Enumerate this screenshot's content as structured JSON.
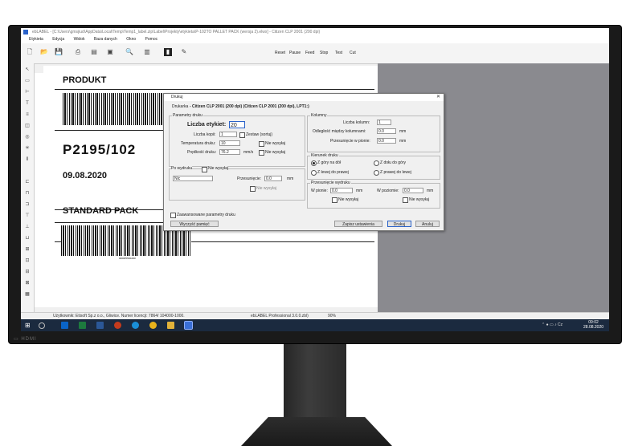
{
  "app": {
    "title": "ebLABEL - [C:\\Users\\gmsjiud\\AppData\\Local\\Temp\\Temp1_label.zip\\Label\\Projekty\\etykieta\\P-102TO PALLET PACK (wersja 2).elwx] - Citizen CLP 2001 (200 dpi)",
    "menu": [
      "Etykieta",
      "Edycja",
      "Widok",
      "Baza danych",
      "Okno",
      "Pomoc"
    ],
    "toolbar_text_buttons": [
      "Reset",
      "Pause",
      "Feed",
      "Stop",
      "Test",
      "Cut"
    ]
  },
  "label": {
    "produkt": "PRODUKT",
    "code": "P2195/102",
    "date": "09.08.2020",
    "standard": "STANDARD PACK",
    "barcode_caption": "0000PP001000"
  },
  "dialog": {
    "title": "Drukuj",
    "printer_label": "Drukarka",
    "printer_value": "- Citizen CLP 2001 (200 dpi) (Citizen CLP 2001 (200 dpi), LPT1:)",
    "print_params": {
      "group": "Parametry druku",
      "count_label": "Liczba etykiet:",
      "count_value": "20",
      "copies_label": "Liczba kopii:",
      "copies_value": "1",
      "collate_label": "Zestaw (sortuj)",
      "temp_label": "Temperatura druku:",
      "temp_value": "10",
      "speed_label": "Prędkość druku:",
      "speed_value": "76.2",
      "speed_unit": "mm/s",
      "no_send": "Nie wysyłaj"
    },
    "columns": {
      "group": "Kolumny",
      "count_label": "Liczba kolumn:",
      "count_value": "1",
      "gap_label": "Odległość między kolumnami:",
      "gap_value": "0.0",
      "shift_label": "Przesunięcie w pionie:",
      "shift_value": "0.0",
      "unit": "mm"
    },
    "direction": {
      "group": "Kierunek druku",
      "options": [
        "Z góry na dół",
        "Z dołu do góry",
        "Z lewej do prawej",
        "Z prawej do lewej"
      ]
    },
    "after_print": {
      "label": "Po wydruku",
      "no_send": "Nie wysyłaj",
      "select_value": "Nic",
      "shift_label": "Przesunięcie:",
      "shift_value": "0.0",
      "unit": "mm"
    },
    "offset": {
      "group": "Przesunięcie wydruku",
      "v_label": "W pionie:",
      "v_value": "0.0",
      "h_label": "W poziomie:",
      "h_value": "0.0",
      "unit": "mm",
      "no_send": "Nie wysyłaj"
    },
    "advanced": "Zaawansowane parametry druku",
    "buttons": {
      "clear": "Wyczyść pamięć",
      "save": "Zapisz ustawienia",
      "print": "Drukuj",
      "cancel": "Anuluj"
    }
  },
  "status": {
    "user": "Użytkownik: Etisoft Sp.z o.o., Gliwice. Numer licencji: 7864/ 104000-1000.",
    "edition": "ebLABEL Professional 3.0.0.zbl)",
    "zoom": "90%"
  },
  "taskbar": {
    "time": "09:02",
    "date": "28.08.2020"
  },
  "colors": {
    "monitor": "#1a1a1a",
    "workarea": "#8a8a8f",
    "taskbar": "#1b2a3f",
    "accent": "#2a62c9"
  }
}
